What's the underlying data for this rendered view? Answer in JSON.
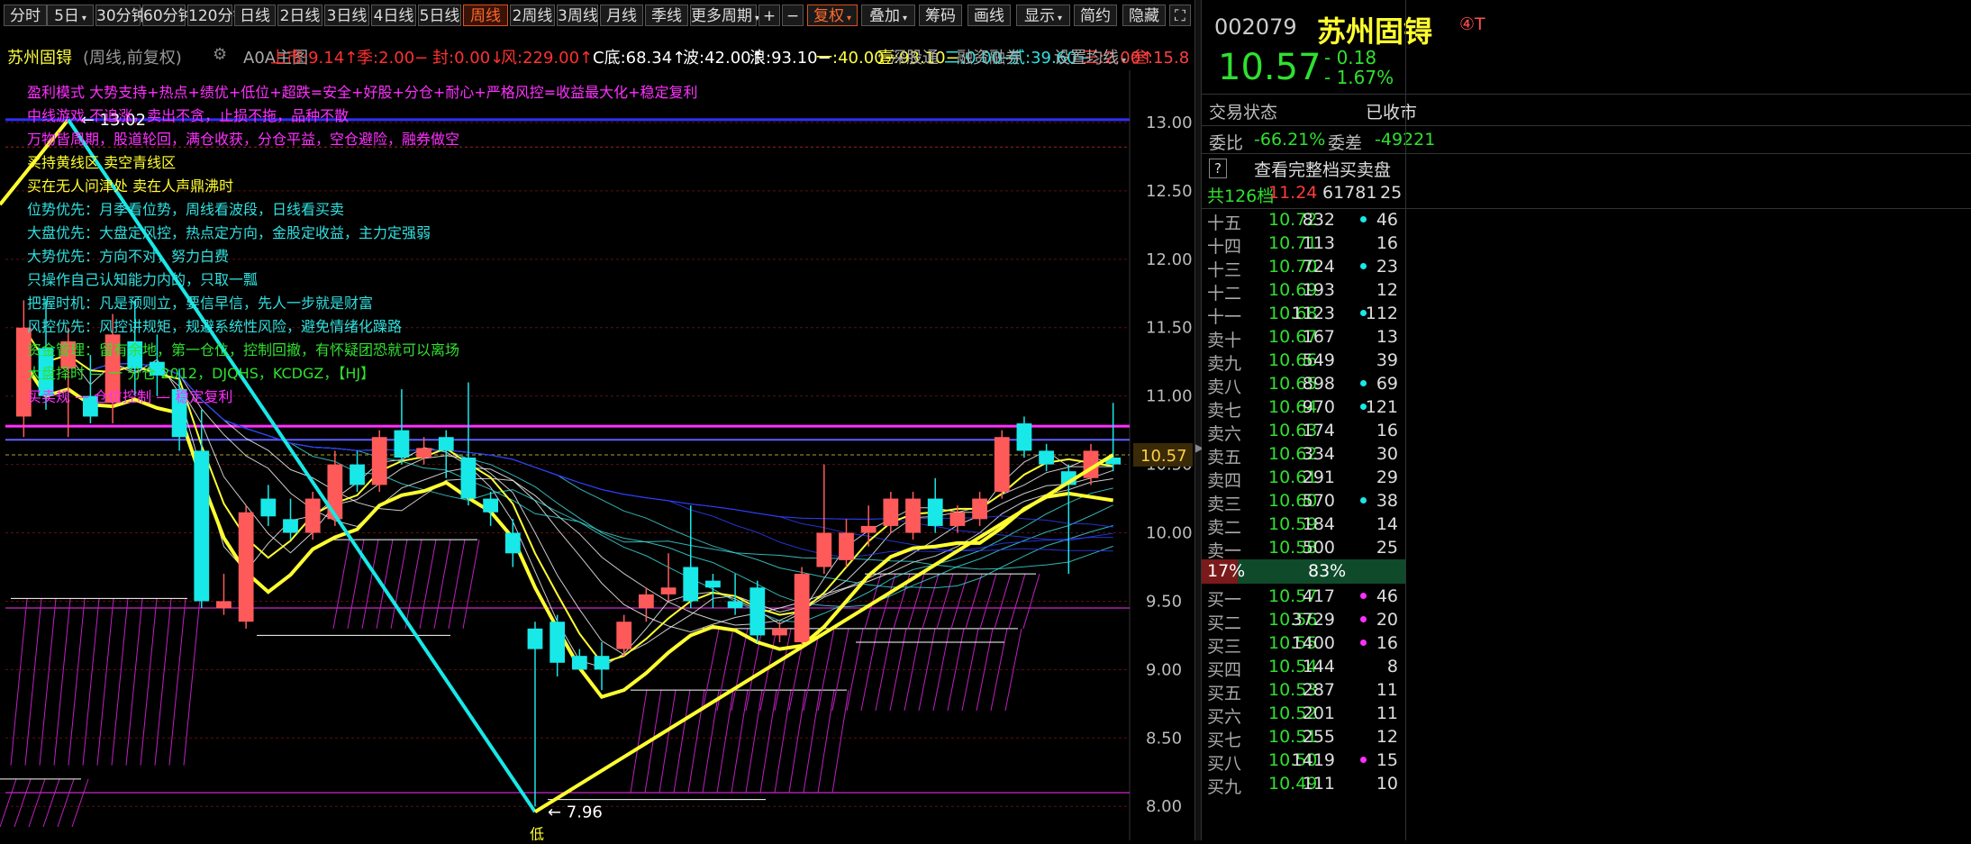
{
  "toolbar": {
    "periods": [
      "分时",
      "5日",
      "30分钟",
      "60分钟",
      "120分钟",
      "日线",
      "2日线",
      "3日线",
      "4日线",
      "5日线",
      "周线",
      "2周线",
      "3周线",
      "月线",
      "季线",
      "更多周期"
    ],
    "active_period": "周线",
    "plus": "+",
    "minus": "−",
    "fuquan": "复权",
    "overlay": "叠加",
    "chips": "筹码",
    "draw": "画线",
    "display": "显示",
    "simple": "简约",
    "hide": "隐藏"
  },
  "info": {
    "stock_name": "苏州固锝",
    "mode": "(周线,前复权)",
    "indicator": "A0A主图",
    "items": [
      {
        "label": "上市:",
        "value": "9.14",
        "arrow": "↑",
        "color": "#ff3030"
      },
      {
        "label": "季:",
        "value": "2.00",
        "arrow": "−",
        "color": "#ff3030"
      },
      {
        "label": "封:",
        "value": "0.00",
        "arrow": "↓",
        "color": "#ff3030"
      },
      {
        "label": "风:",
        "value": "229.00",
        "arrow": "↑",
        "color": "#ff3030"
      },
      {
        "label": "C底:",
        "value": "68.34",
        "arrow": "↑",
        "color": "#ffffff"
      },
      {
        "label": "波:",
        "value": "42.00",
        "arrow": "↑",
        "color": "#ffffff"
      },
      {
        "label": "浪:",
        "value": "93.10",
        "arrow": "−",
        "color": "#ffffff"
      },
      {
        "label": "一:",
        "value": "40.00",
        "arrow": "−",
        "color": "#ffff40"
      },
      {
        "label": "壹:",
        "value": "93.10",
        "arrow": "−",
        "color": "#ffff40"
      },
      {
        "label": "二:",
        "value": "0.00",
        "arrow": "−",
        "color": "#30e0e0"
      },
      {
        "label": "贰:",
        "value": "39.60",
        "arrow": "−",
        "color": "#30e0e0"
      },
      {
        "label": "三:",
        "value": "2.00",
        "arrow": "↑",
        "color": "#ff4040"
      },
      {
        "label": "叁:",
        "value": "15.8",
        "arrow": "",
        "color": "#ff4040"
      }
    ],
    "links": [
      "深股通",
      "融资融券",
      "设置均线"
    ]
  },
  "annotations": [
    {
      "text": "盈利模式 大势支持+热点+绩优+低位+超跌=安全+好股+分仓+耐心+严格风控=收益最大化+稳定复利",
      "color": "#ff30ff"
    },
    {
      "text": "中线游戏 不追涨，卖出不贪，止损不拖，品种不散",
      "color": "#ff30ff"
    },
    {
      "text": "万物皆周期，股道轮回，满仓收获，分仓平益，空仓避险，融券做空",
      "color": "#ff30ff"
    },
    {
      "text": "买持黄线区    卖空青线区",
      "color": "#ffff30"
    },
    {
      "text": "买在无人问津处 卖在人声鼎沸时",
      "color": "#ffff30"
    },
    {
      "text": "位势优先：月季看位势，周线看波段，日线看买卖",
      "color": "#30e0e0"
    },
    {
      "text": "大盘优先：大盘定风控，热点定方向，金股定收益，主力定强弱",
      "color": "#30e0e0"
    },
    {
      "text": "大势优先：方向不对，努力白费",
      "color": "#30e0e0"
    },
    {
      "text": "只操作自己认知能力内的，只取一瓢",
      "color": "#30e0e0"
    },
    {
      "text": "把握时机：凡是预则立，要信早信，先人一步就是财富",
      "color": "#30e0e0"
    },
    {
      "text": "风控优先：风控讲规矩，规避系统性风险，避免情绪化躁路",
      "color": "#30e0e0"
    },
    {
      "text": "资金管理：留有余地，第一仓位，控制回撤，有怀疑团恐就可以离场",
      "color": "#30e030"
    },
    {
      "text": "大盘择时 — 一 分仓 2012，DJQHS，KCDGZ，【HJ】",
      "color": "#30e030"
    },
    {
      "text": "买卖规 — 仓位控制 — 稳定复利",
      "color": "#ff30ff"
    }
  ],
  "chart_data": {
    "type": "candlestick",
    "title": "苏州固锝 (周线,前复权)",
    "ylim": [
      7.85,
      13.25
    ],
    "y_ticks": [
      "13.00",
      "12.50",
      "12.00",
      "11.50",
      "11.00",
      "10.50",
      "10.00",
      "9.50",
      "9.00",
      "8.50",
      "8.00"
    ],
    "current_price_label": "10.57",
    "high_label": "13.02",
    "low_label": "7.96",
    "low_marker": "低",
    "candles": [
      {
        "o": 10.85,
        "h": 11.7,
        "l": 10.7,
        "c": 11.5
      },
      {
        "o": 11.35,
        "h": 11.7,
        "l": 10.9,
        "c": 11.0
      },
      {
        "o": 11.2,
        "h": 11.5,
        "l": 10.7,
        "c": 11.4
      },
      {
        "o": 11.0,
        "h": 11.3,
        "l": 10.8,
        "c": 10.85
      },
      {
        "o": 10.95,
        "h": 11.6,
        "l": 10.8,
        "c": 11.45
      },
      {
        "o": 11.4,
        "h": 11.7,
        "l": 11.0,
        "c": 11.2
      },
      {
        "o": 11.25,
        "h": 11.45,
        "l": 11.0,
        "c": 11.15
      },
      {
        "o": 11.05,
        "h": 11.2,
        "l": 10.6,
        "c": 10.7
      },
      {
        "o": 10.6,
        "h": 10.9,
        "l": 9.45,
        "c": 9.5
      },
      {
        "o": 9.45,
        "h": 9.7,
        "l": 9.4,
        "c": 9.5
      },
      {
        "o": 9.35,
        "h": 10.2,
        "l": 9.3,
        "c": 10.15
      },
      {
        "o": 10.25,
        "h": 10.35,
        "l": 10.05,
        "c": 10.12
      },
      {
        "o": 10.1,
        "h": 10.25,
        "l": 9.95,
        "c": 10.0
      },
      {
        "o": 10.0,
        "h": 10.3,
        "l": 9.95,
        "c": 10.25
      },
      {
        "o": 10.1,
        "h": 10.6,
        "l": 10.05,
        "c": 10.5
      },
      {
        "o": 10.5,
        "h": 10.6,
        "l": 10.3,
        "c": 10.35
      },
      {
        "o": 10.35,
        "h": 10.75,
        "l": 10.3,
        "c": 10.7
      },
      {
        "o": 10.75,
        "h": 11.05,
        "l": 10.5,
        "c": 10.55
      },
      {
        "o": 10.55,
        "h": 10.7,
        "l": 10.5,
        "c": 10.62
      },
      {
        "o": 10.7,
        "h": 10.75,
        "l": 10.4,
        "c": 10.6
      },
      {
        "o": 10.55,
        "h": 11.1,
        "l": 10.2,
        "c": 10.25
      },
      {
        "o": 10.25,
        "h": 10.3,
        "l": 10.05,
        "c": 10.15
      },
      {
        "o": 10.0,
        "h": 10.1,
        "l": 9.75,
        "c": 9.85
      },
      {
        "o": 9.3,
        "h": 9.35,
        "l": 8.0,
        "c": 9.15
      },
      {
        "o": 9.35,
        "h": 9.4,
        "l": 8.95,
        "c": 9.05
      },
      {
        "o": 9.1,
        "h": 9.15,
        "l": 9.0,
        "c": 9.0
      },
      {
        "o": 9.1,
        "h": 9.2,
        "l": 8.85,
        "c": 9.0
      },
      {
        "o": 9.15,
        "h": 9.4,
        "l": 9.1,
        "c": 9.35
      },
      {
        "o": 9.45,
        "h": 9.6,
        "l": 9.35,
        "c": 9.55
      },
      {
        "o": 9.55,
        "h": 9.85,
        "l": 9.5,
        "c": 9.6
      },
      {
        "o": 9.75,
        "h": 10.2,
        "l": 9.45,
        "c": 9.5
      },
      {
        "o": 9.65,
        "h": 9.7,
        "l": 9.45,
        "c": 9.6
      },
      {
        "o": 9.5,
        "h": 9.7,
        "l": 9.4,
        "c": 9.45
      },
      {
        "o": 9.6,
        "h": 9.65,
        "l": 9.2,
        "c": 9.25
      },
      {
        "o": 9.25,
        "h": 9.35,
        "l": 9.2,
        "c": 9.3
      },
      {
        "o": 9.2,
        "h": 9.75,
        "l": 9.15,
        "c": 9.7
      },
      {
        "o": 9.75,
        "h": 10.5,
        "l": 9.7,
        "c": 10.0
      },
      {
        "o": 9.8,
        "h": 10.1,
        "l": 9.75,
        "c": 10.0
      },
      {
        "o": 10.0,
        "h": 10.2,
        "l": 9.9,
        "c": 10.05
      },
      {
        "o": 10.05,
        "h": 10.3,
        "l": 10.0,
        "c": 10.25
      },
      {
        "o": 10.0,
        "h": 10.3,
        "l": 9.95,
        "c": 10.25
      },
      {
        "o": 10.25,
        "h": 10.4,
        "l": 10.0,
        "c": 10.05
      },
      {
        "o": 10.05,
        "h": 10.2,
        "l": 10.0,
        "c": 10.15
      },
      {
        "o": 10.1,
        "h": 10.3,
        "l": 10.05,
        "c": 10.25
      },
      {
        "o": 10.3,
        "h": 10.75,
        "l": 10.25,
        "c": 10.7
      },
      {
        "o": 10.8,
        "h": 10.85,
        "l": 10.55,
        "c": 10.6
      },
      {
        "o": 10.6,
        "h": 10.65,
        "l": 10.45,
        "c": 10.5
      },
      {
        "o": 10.45,
        "h": 10.5,
        "l": 9.7,
        "c": 10.35
      },
      {
        "o": 10.4,
        "h": 10.65,
        "l": 10.35,
        "c": 10.6
      },
      {
        "o": 10.55,
        "h": 10.95,
        "l": 10.45,
        "c": 10.5
      }
    ]
  },
  "panel": {
    "code": "002079",
    "name": "苏州固锝",
    "flags": "④T",
    "price": "10.57",
    "change": "- 0.18",
    "change_pct": "- 1.67%",
    "trade_status_label": "交易状态",
    "trade_status": "已收市",
    "weibi_label": "委比",
    "weibi": "-66.21%",
    "weicha_label": "委差",
    "weicha": "-49221",
    "help_label": "?",
    "full_book_label": "查看完整档买卖盘",
    "total_levels": "共126档",
    "total_price": "11.24",
    "total_volume": "61781",
    "total_count": "25",
    "sell_pct": "17%",
    "buy_pct": "83%",
    "sells": [
      {
        "label": "十五",
        "price": "10.72",
        "vol": "832",
        "count": "46"
      },
      {
        "label": "十四",
        "price": "10.71",
        "vol": "113",
        "count": "16"
      },
      {
        "label": "十三",
        "price": "10.70",
        "vol": "724",
        "count": "23"
      },
      {
        "label": "十二",
        "price": "10.69",
        "vol": "193",
        "count": "12"
      },
      {
        "label": "十一",
        "price": "10.68",
        "vol": "1123",
        "count": "112"
      },
      {
        "label": "卖十",
        "price": "10.67",
        "vol": "167",
        "count": "13"
      },
      {
        "label": "卖九",
        "price": "10.66",
        "vol": "549",
        "count": "39"
      },
      {
        "label": "卖八",
        "price": "10.65",
        "vol": "898",
        "count": "69"
      },
      {
        "label": "卖七",
        "price": "10.64",
        "vol": "970",
        "count": "121"
      },
      {
        "label": "卖六",
        "price": "10.63",
        "vol": "174",
        "count": "16"
      },
      {
        "label": "卖五",
        "price": "10.62",
        "vol": "334",
        "count": "30"
      },
      {
        "label": "卖四",
        "price": "10.61",
        "vol": "291",
        "count": "29"
      },
      {
        "label": "卖三",
        "price": "10.60",
        "vol": "570",
        "count": "38"
      },
      {
        "label": "卖二",
        "price": "10.59",
        "vol": "184",
        "count": "14"
      },
      {
        "label": "卖一",
        "price": "10.58",
        "vol": "500",
        "count": "25"
      }
    ],
    "buys": [
      {
        "label": "买一",
        "price": "10.57",
        "vol": "417",
        "count": "46"
      },
      {
        "label": "买二",
        "price": "10.56",
        "vol": "3729",
        "count": "20"
      },
      {
        "label": "买三",
        "price": "10.55",
        "vol": "1400",
        "count": "16"
      },
      {
        "label": "买四",
        "price": "10.54",
        "vol": "144",
        "count": "8"
      },
      {
        "label": "买五",
        "price": "10.53",
        "vol": "287",
        "count": "11"
      },
      {
        "label": "买六",
        "price": "10.52",
        "vol": "201",
        "count": "11"
      },
      {
        "label": "买七",
        "price": "10.51",
        "vol": "255",
        "count": "12"
      },
      {
        "label": "买八",
        "price": "10.50",
        "vol": "1419",
        "count": "15"
      },
      {
        "label": "买九",
        "price": "10.49",
        "vol": "111",
        "count": "10"
      }
    ],
    "colors": {
      "up": "#ff3b3b",
      "down": "#18e8e8",
      "green": "#30e030",
      "yellow": "#ffff30",
      "magenta": "#ff30ff"
    }
  }
}
